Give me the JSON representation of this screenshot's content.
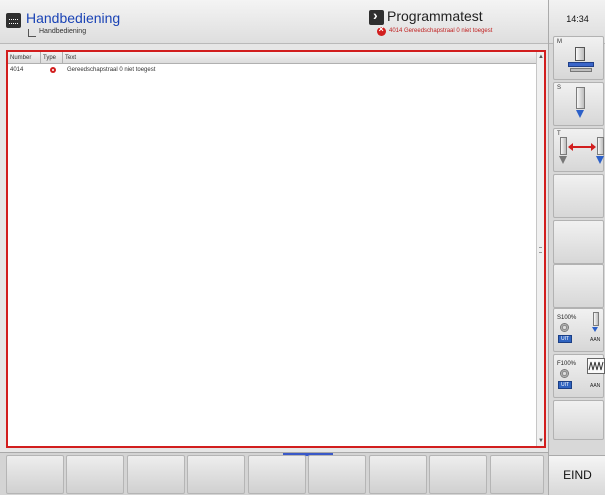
{
  "header": {
    "left_mode": {
      "title": "Handbediening",
      "subtitle": "Handbediening"
    },
    "right_mode": {
      "title": "Programmatest",
      "error_message": "4014 Gereedschapstraal 0 niet toegest"
    }
  },
  "clock": {
    "time": "14:34"
  },
  "sidebar": {
    "m_label": "M",
    "s_label": "S",
    "t_label": "T",
    "spindle_override": {
      "value": "S100%",
      "status": "UIT",
      "state": "AAN"
    },
    "feed_override": {
      "value": "F100%",
      "status": "UIT",
      "state": "AAN"
    },
    "end_label": "EIND"
  },
  "error_table": {
    "columns": [
      "Number",
      "Type",
      "Text"
    ],
    "rows": [
      {
        "number": "4014",
        "type": "error-icon",
        "text": "Gereedschapstraal 0 niet toegest"
      }
    ]
  },
  "colors": {
    "accent_blue": "#1a43b5",
    "error_red": "#d21e1e",
    "active_indicator": "#3a59c8"
  }
}
